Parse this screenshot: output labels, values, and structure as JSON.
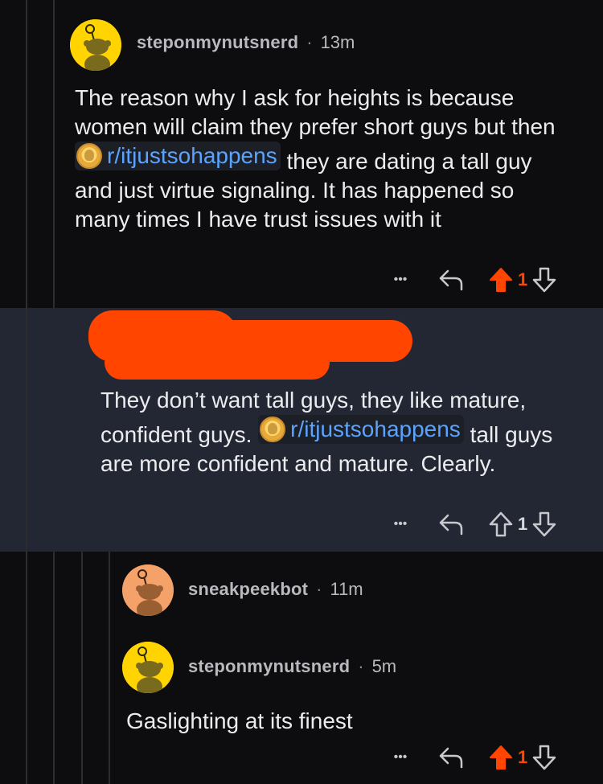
{
  "comments": [
    {
      "username": "steponmynutsnerd",
      "separator": "·",
      "time": "13m",
      "text_before": "The reason why I ask for heights is because women will claim they prefer short guys but then",
      "subreddit": "r/itjustsohappens",
      "text_after": "they are dating a tall guy and just virtue signaling. It has happened so many times I have trust issues with it",
      "more_label": "•••",
      "vote_count": "1",
      "upvoted": true
    },
    {
      "username": "[redacted]",
      "text_before": "They don’t want tall guys, they like mature, confident guys.",
      "subreddit": "r/itjustsohappens",
      "text_after": "tall guys are more confident and mature. Clearly.",
      "more_label": "•••",
      "vote_count": "1",
      "upvoted": false
    },
    {
      "username": "sneakpeekbot",
      "separator": "·",
      "time": "11m"
    },
    {
      "username": "steponmynutsnerd",
      "separator": "·",
      "time": "5m",
      "text": "Gaslighting at its finest",
      "more_label": "•••",
      "vote_count": "1",
      "upvoted": true
    }
  ],
  "colors": {
    "background": "#0d0d0f",
    "highlight": "#222733",
    "link": "#5aa3ff",
    "upvote": "#ff4500",
    "redaction": "#ff4500"
  },
  "icons": [
    "more-icon",
    "reply-icon",
    "upvote-icon",
    "downvote-icon",
    "snoo-avatar-icon",
    "subreddit-icon"
  ]
}
